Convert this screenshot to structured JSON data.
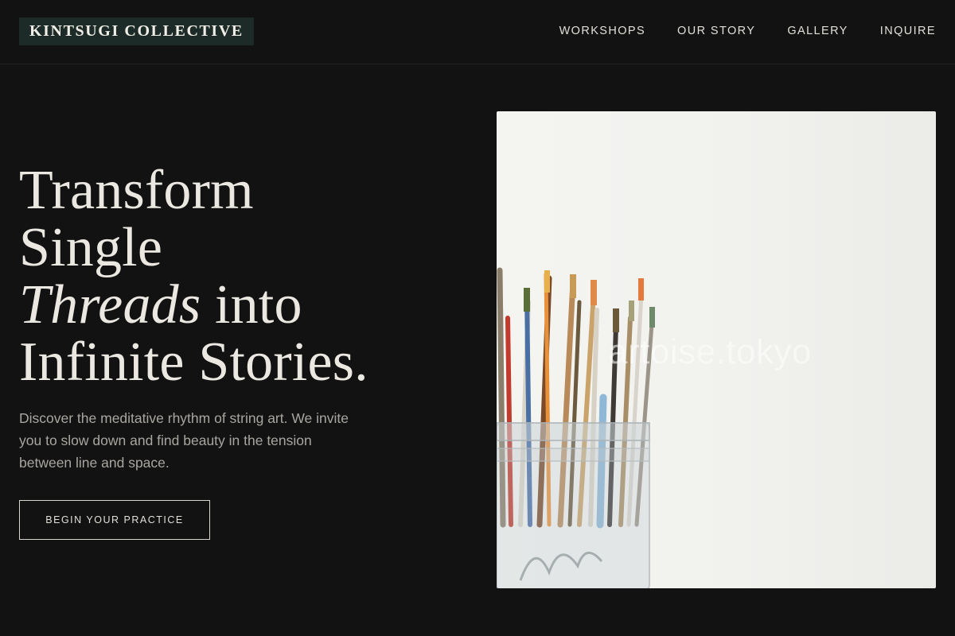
{
  "header": {
    "logo": "KINTSUGI COLLECTIVE",
    "nav": [
      "WORKSHOPS",
      "OUR STORY",
      "GALLERY",
      "INQUIRE"
    ]
  },
  "hero": {
    "heading": {
      "line1": "Transform",
      "line2": "Single",
      "line3_italic": "Threads",
      "line3_rest": " into",
      "line4": "Infinite Stories."
    },
    "subtext": "Discover the meditative rhythm of string art. We invite you to slow down and find beauty in the tension between line and space.",
    "cta_label": "BEGIN YOUR PRACTICE",
    "image_watermark": "artoise.tokyo"
  },
  "colors": {
    "background": "#121212",
    "logo_background": "#1c2b27",
    "text_primary": "#ebe8e2",
    "text_muted": "#a9a6a1"
  }
}
